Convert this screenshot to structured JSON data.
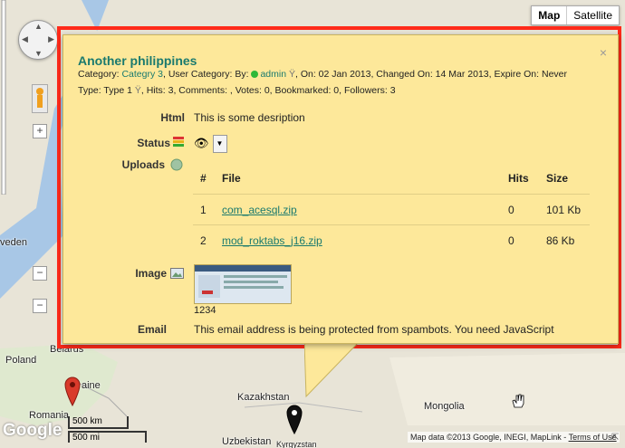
{
  "map": {
    "type_buttons": [
      "Map",
      "Satellite"
    ],
    "labels": {
      "sweden": "veden",
      "belarus": "Belarus",
      "poland": "Poland",
      "ukraine": "aine",
      "romania": "Romania",
      "kazakhstan": "Kazakhstan",
      "mongolia": "Mongolia",
      "uzbekistan": "Uzbekistan",
      "kyrgyzstan": "Kyrgyzstan"
    },
    "scale": {
      "km": "500 km",
      "mi": "500 mi"
    },
    "google_logo": "Google",
    "attribution": "Map data ©2013 Google, INEGI, MapLink",
    "terms_link": "Terms of Use",
    "colors": {
      "water": "#a8c7e6",
      "land": "#e8e4d7",
      "highlight_border": "#ff2a1a",
      "bubble": "#fde89a"
    }
  },
  "popup": {
    "title": "Another philippines",
    "close_glyph": "×",
    "meta1": {
      "category_prefix": "Category: ",
      "category_link": "Categry 3",
      "user_category_prefix": ", User Category: By: ",
      "author": "admin",
      "rest": ", On: 02 Jan 2013, Changed On: 14 Mar 2013, Expire On: Never"
    },
    "meta2": {
      "type_prefix": "Type: Type 1",
      "rest": ", Hits: 3, Comments: , Votes: 0, Bookmarked: 0, Followers: 3"
    },
    "html_label": "Html",
    "html_value": "This is some desription",
    "status_label": "Status",
    "uploads_label": "Uploads",
    "files": {
      "headers": [
        "#",
        "File",
        "Hits",
        "Size"
      ],
      "rows": [
        [
          "1",
          "com_acesql.zip",
          "0",
          "101 Kb"
        ],
        [
          "2",
          "mod_roktabs_j16.zip",
          "0",
          "86 Kb"
        ]
      ]
    },
    "image_label": "Image",
    "image_caption": "1234",
    "email_label": "Email",
    "email_value": "This email address is being protected from spambots. You need JavaScript"
  }
}
